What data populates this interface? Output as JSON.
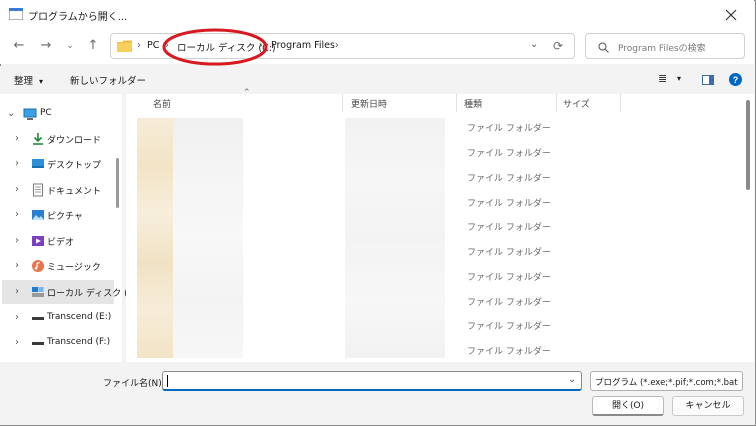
{
  "window": {
    "title": "プログラムから開く..."
  },
  "address": {
    "crumbs": [
      "PC",
      "ローカル ディスク (C:)",
      "Program Files"
    ],
    "separator": "›"
  },
  "search": {
    "placeholder": "Program Filesの検索"
  },
  "toolbar": {
    "organize": "整理",
    "new_folder": "新しいフォルダー"
  },
  "sidebar": {
    "items": [
      {
        "label": "PC",
        "icon": "pc-icon"
      },
      {
        "label": "ダウンロード",
        "icon": "download-icon"
      },
      {
        "label": "デスクトップ",
        "icon": "desktop-icon"
      },
      {
        "label": "ドキュメント",
        "icon": "documents-icon"
      },
      {
        "label": "ピクチャ",
        "icon": "pictures-icon"
      },
      {
        "label": "ビデオ",
        "icon": "videos-icon"
      },
      {
        "label": "ミュージック",
        "icon": "music-icon"
      },
      {
        "label": "ローカル ディスク (",
        "icon": "local-disk-icon"
      },
      {
        "label": "Transcend (E:)",
        "icon": "drive-icon"
      },
      {
        "label": "Transcend (F:)",
        "icon": "drive-icon"
      }
    ]
  },
  "columns": {
    "name": "名前",
    "date": "更新日時",
    "type": "種類",
    "size": "サイズ"
  },
  "rows": [
    {
      "type": "ファイル フォルダー"
    },
    {
      "type": "ファイル フォルダー"
    },
    {
      "type": "ファイル フォルダー"
    },
    {
      "type": "ファイル フォルダー"
    },
    {
      "type": "ファイル フォルダー"
    },
    {
      "type": "ファイル フォルダー"
    },
    {
      "type": "ファイル フォルダー"
    },
    {
      "type": "ファイル フォルダー"
    },
    {
      "type": "ファイル フォルダー"
    },
    {
      "type": "ファイル フォルダー"
    }
  ],
  "footer": {
    "filename_label": "ファイル名(N):",
    "filename_value": "",
    "filetype": "プログラム (*.exe;*.pif;*.com;*.bat",
    "open": "開く(O)",
    "cancel": "キャンセル"
  },
  "colors": {
    "accent": "#0067c0",
    "annotation": "#d71920"
  }
}
